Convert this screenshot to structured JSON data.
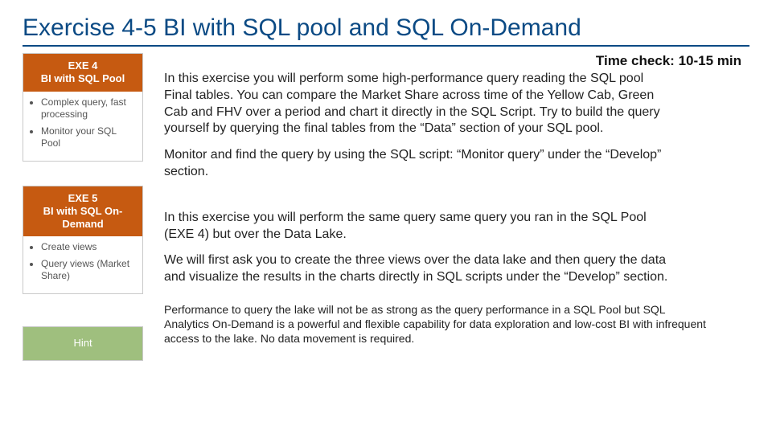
{
  "title": "Exercise 4-5 BI with SQL pool and SQL On-Demand",
  "time_check": "Time check: 10-15 min",
  "sidebar": {
    "exe4": {
      "line1": "EXE 4",
      "line2": "BI with SQL Pool",
      "bullets": [
        "Complex query, fast processing",
        "Monitor your SQL Pool"
      ]
    },
    "exe5": {
      "line1": "EXE 5",
      "line2": "BI with SQL On-Demand",
      "bullets": [
        "Create views",
        "Query views (Market Share)"
      ]
    },
    "hint": {
      "label": "Hint"
    }
  },
  "body": {
    "p1": "In this exercise you will perform some high-performance query reading the SQL pool Final tables. You can compare the Market Share across time of the Yellow Cab, Green Cab and FHV over a period and chart it directly in the SQL Script. Try to build the query yourself by querying the final tables from the “Data” section of your SQL pool.",
    "p2": "Monitor and find the query by using the SQL script: “Monitor query” under the “Develop” section.",
    "p3": "In this exercise you will perform the same query same query you ran in the SQL Pool (EXE 4) but over the Data Lake.",
    "p4": "We will first ask you to create the three views over the data lake and then query the data and visualize the results in the charts directly in SQL scripts under the “Develop” section.",
    "p5": "Performance to query the lake will not be as strong as the query performance in a SQL Pool but SQL Analytics On-Demand is a powerful and flexible capability for data exploration and low-cost BI with infrequent access to the lake. No data movement is required."
  }
}
